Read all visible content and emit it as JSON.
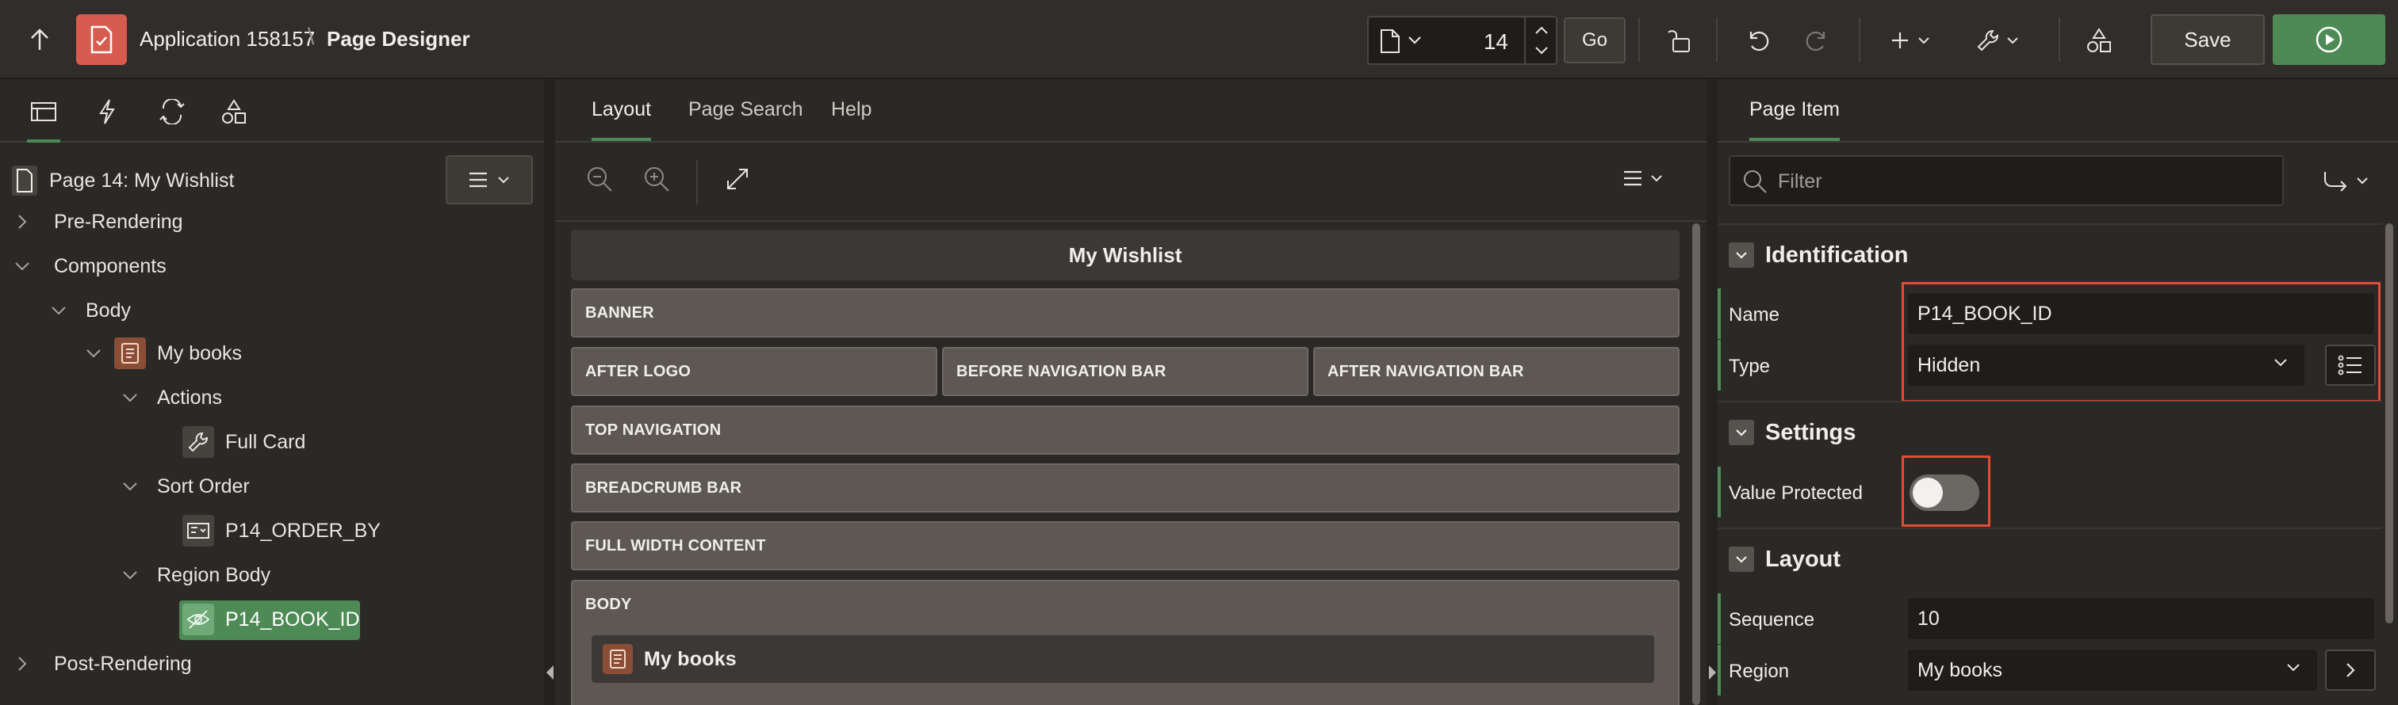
{
  "toolbar": {
    "app_title": "Application 158157",
    "separator": "\\",
    "page_designer_title": "Page Designer",
    "page_number": "14",
    "go_label": "Go",
    "save_label": "Save"
  },
  "left_panel": {
    "tabs": [
      "rendering-tree",
      "dynamic-actions",
      "processing",
      "shared-components"
    ],
    "tree": {
      "page_label": "Page 14: My Wishlist",
      "items": [
        {
          "label": "Pre-Rendering",
          "level": 0
        },
        {
          "label": "Components",
          "level": 0
        },
        {
          "label": "Body",
          "level": 1
        },
        {
          "label": "My books",
          "level": 2
        },
        {
          "label": "Actions",
          "level": 3
        },
        {
          "label": "Full Card",
          "level": 4
        },
        {
          "label": "Sort Order",
          "level": 3
        },
        {
          "label": "P14_ORDER_BY",
          "level": 4
        },
        {
          "label": "Region Body",
          "level": 3
        },
        {
          "label": "P14_BOOK_ID",
          "level": 4,
          "selected": true
        },
        {
          "label": "Post-Rendering",
          "level": 0
        }
      ]
    }
  },
  "center_panel": {
    "tabs": [
      "Layout",
      "Page Search",
      "Help"
    ],
    "active_tab": "Layout",
    "canvas": {
      "title": "My Wishlist",
      "zones": {
        "banner": "BANNER",
        "after_logo": "AFTER LOGO",
        "before_nav": "BEFORE NAVIGATION BAR",
        "after_nav": "AFTER NAVIGATION BAR",
        "top_nav": "TOP NAVIGATION",
        "breadcrumb": "BREADCRUMB BAR",
        "full_width": "FULL WIDTH CONTENT",
        "body": "BODY"
      },
      "region_label": "My books"
    }
  },
  "right_panel": {
    "tab": "Page Item",
    "filter_placeholder": "Filter",
    "groups": {
      "identification": "Identification",
      "settings": "Settings",
      "layout": "Layout"
    },
    "props": {
      "name_label": "Name",
      "name_value": "P14_BOOK_ID",
      "type_label": "Type",
      "type_value": "Hidden",
      "value_protected_label": "Value Protected",
      "value_protected_on": false,
      "sequence_label": "Sequence",
      "sequence_value": "10",
      "region_label": "Region",
      "region_value": "My books"
    }
  },
  "colors": {
    "accent_green": "#4e8a56",
    "app_logo": "#d75c4f",
    "highlight_red": "#e14c33",
    "panel_bg": "#2b2926"
  }
}
